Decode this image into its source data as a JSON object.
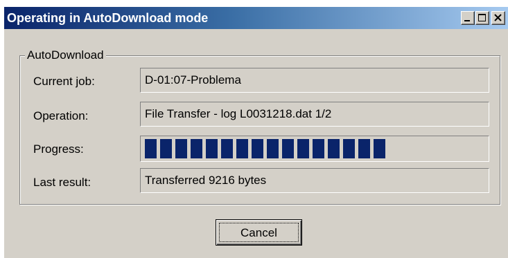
{
  "window": {
    "title": "Operating in AutoDownload mode",
    "title_buttons": [
      "minimize-icon",
      "maximize-icon",
      "close-icon"
    ],
    "colors": {
      "titlebar_start": "#0a246a",
      "titlebar_end": "#a6caf0",
      "face": "#d4d0c8",
      "progress": "#0a246a"
    }
  },
  "group": {
    "legend": "AutoDownload",
    "current_job": {
      "label": "Current job:",
      "value": "D-01:07-Problema"
    },
    "operation": {
      "label": "Operation:",
      "value": "File Transfer - log L0031218.dat 1/2"
    },
    "progress": {
      "label": "Progress:",
      "blocks_filled": 16,
      "percent": 72
    },
    "last_result": {
      "label": "Last result:",
      "value": "Transferred 9216 bytes"
    }
  },
  "buttons": {
    "cancel_label": "Cancel"
  }
}
